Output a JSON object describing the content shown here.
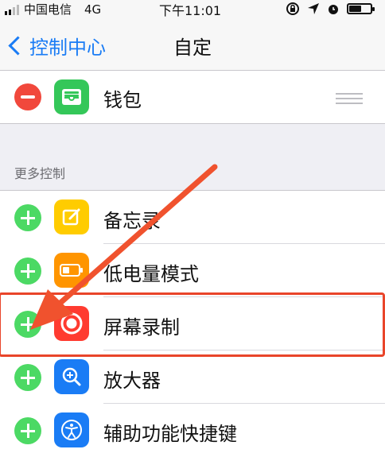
{
  "status_bar": {
    "carrier": "中国电信",
    "network": "4G",
    "time": "下午11:01",
    "battery_level": 0.55
  },
  "nav": {
    "back_label": "控制中心",
    "title": "自定"
  },
  "included": [
    {
      "label": "钱包",
      "icon": "wallet-icon",
      "icon_color": "#34c759"
    }
  ],
  "section_header": "更多控制",
  "more_controls": [
    {
      "label": "备忘录",
      "icon": "notes-icon",
      "icon_color": "#ffcc00"
    },
    {
      "label": "低电量模式",
      "icon": "low-power-icon",
      "icon_color": "#ff9500"
    },
    {
      "label": "屏幕录制",
      "icon": "screen-record-icon",
      "icon_color": "#ff3b30"
    },
    {
      "label": "放大器",
      "icon": "magnifier-icon",
      "icon_color": "#1a7cf5"
    },
    {
      "label": "辅助功能快捷键",
      "icon": "accessibility-icon",
      "icon_color": "#1a7cf5"
    }
  ],
  "colors": {
    "add": "#4cd964",
    "remove": "#f1483c",
    "annotation": "#e9452a",
    "accent": "#1a7cf5"
  }
}
